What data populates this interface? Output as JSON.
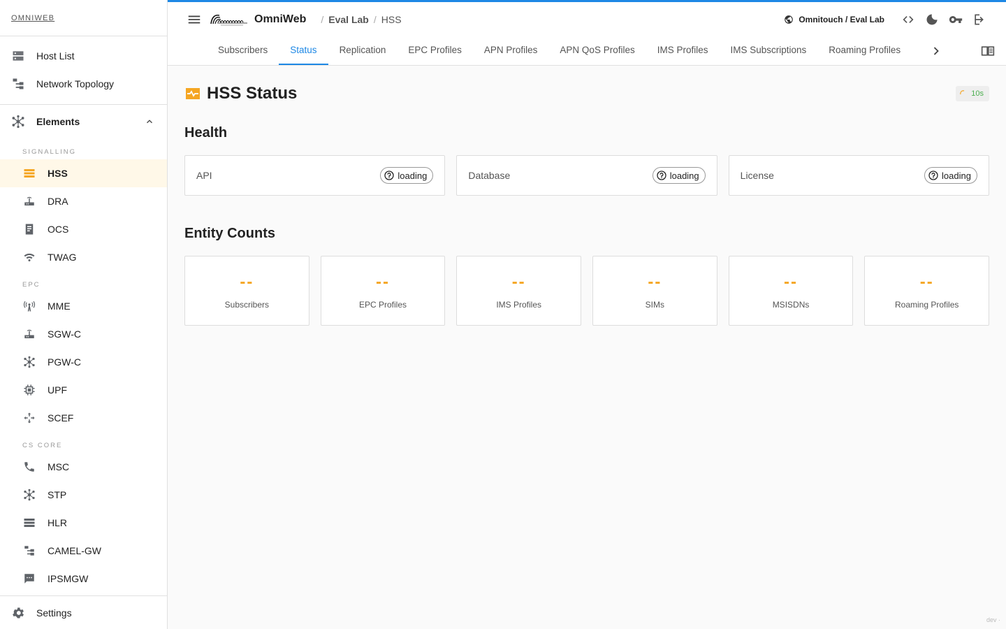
{
  "brand": {
    "link_text": "OMNIWEB"
  },
  "nav": {
    "items": [
      {
        "label": "Host List",
        "icon": "host-list-icon"
      },
      {
        "label": "Network Topology",
        "icon": "topology-icon"
      }
    ],
    "elements_group": {
      "label": "Elements",
      "icon": "elements-icon",
      "expanded": true
    }
  },
  "sections": {
    "signalling": "SIGNALLING",
    "epc": "EPC",
    "cs_core": "CS CORE"
  },
  "elements": {
    "signalling": [
      {
        "label": "HSS",
        "icon": "storage-icon",
        "active": true
      },
      {
        "label": "DRA",
        "icon": "router-icon"
      },
      {
        "label": "OCS",
        "icon": "ocs-icon"
      },
      {
        "label": "TWAG",
        "icon": "wifi-icon"
      }
    ],
    "epc": [
      {
        "label": "MME",
        "icon": "antenna-icon"
      },
      {
        "label": "SGW-C",
        "icon": "router-icon"
      },
      {
        "label": "PGW-C",
        "icon": "hub-icon"
      },
      {
        "label": "UPF",
        "icon": "chip-icon"
      },
      {
        "label": "SCEF",
        "icon": "move-icon"
      }
    ],
    "cs_core": [
      {
        "label": "MSC",
        "icon": "phone-icon"
      },
      {
        "label": "STP",
        "icon": "hub-icon"
      },
      {
        "label": "HLR",
        "icon": "storage-icon"
      },
      {
        "label": "CAMEL-GW",
        "icon": "topology-icon"
      },
      {
        "label": "IPSMGW",
        "icon": "sms-icon"
      }
    ]
  },
  "settings": {
    "label": "Settings"
  },
  "topbar": {
    "app_name": "OmniWeb",
    "breadcrumb": [
      "Eval Lab",
      "HSS"
    ],
    "tenant": "Omnitouch / Eval Lab"
  },
  "tabs": [
    {
      "label": "Subscribers",
      "active": false
    },
    {
      "label": "Status",
      "active": true
    },
    {
      "label": "Replication",
      "active": false
    },
    {
      "label": "EPC Profiles",
      "active": false
    },
    {
      "label": "APN Profiles",
      "active": false
    },
    {
      "label": "APN QoS Profiles",
      "active": false
    },
    {
      "label": "IMS Profiles",
      "active": false
    },
    {
      "label": "IMS Subscriptions",
      "active": false
    },
    {
      "label": "Roaming Profiles",
      "active": false
    }
  ],
  "page": {
    "title": "HSS Status",
    "refresh_interval": "10s",
    "health_title": "Health",
    "health": [
      {
        "label": "API",
        "status": "loading"
      },
      {
        "label": "Database",
        "status": "loading"
      },
      {
        "label": "License",
        "status": "loading"
      }
    ],
    "entity_title": "Entity Counts",
    "counts": [
      {
        "label": "Subscribers",
        "value": "--"
      },
      {
        "label": "EPC Profiles",
        "value": "--"
      },
      {
        "label": "IMS Profiles",
        "value": "--"
      },
      {
        "label": "SIMs",
        "value": "--"
      },
      {
        "label": "MSISDNs",
        "value": "--"
      },
      {
        "label": "Roaming Profiles",
        "value": "--"
      }
    ]
  },
  "colors": {
    "accent": "#1e88e5",
    "highlight": "#f5a623",
    "ok": "#4caf50"
  },
  "footer_tag": "dev ·"
}
